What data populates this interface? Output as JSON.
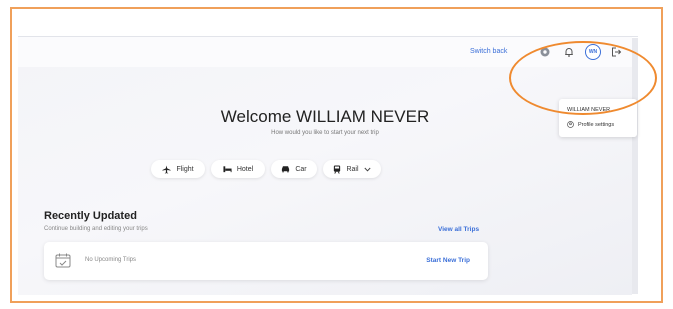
{
  "header": {
    "switch_back_label": "Switch back",
    "avatar_initials": "WN"
  },
  "profile_menu": {
    "user_name": "WILLIAM NEVER",
    "profile_settings_label": "Profile settings"
  },
  "hero": {
    "welcome_text": "Welcome WILLIAM NEVER",
    "subtitle": "How would you like to start your next trip"
  },
  "travel_options": [
    {
      "label": "Flight",
      "icon": "plane-icon"
    },
    {
      "label": "Hotel",
      "icon": "bed-icon"
    },
    {
      "label": "Car",
      "icon": "car-icon"
    },
    {
      "label": "Rail",
      "icon": "train-icon"
    }
  ],
  "recent": {
    "title": "Recently Updated",
    "subtitle": "Continue building and editing your trips",
    "view_all_label": "View all Trips",
    "empty_text": "No Upcoming Trips",
    "start_new_label": "Start New Trip"
  },
  "colors": {
    "accent": "#3b6fd8",
    "highlight": "#ef8a2f",
    "frame_border": "#f0a05a"
  }
}
